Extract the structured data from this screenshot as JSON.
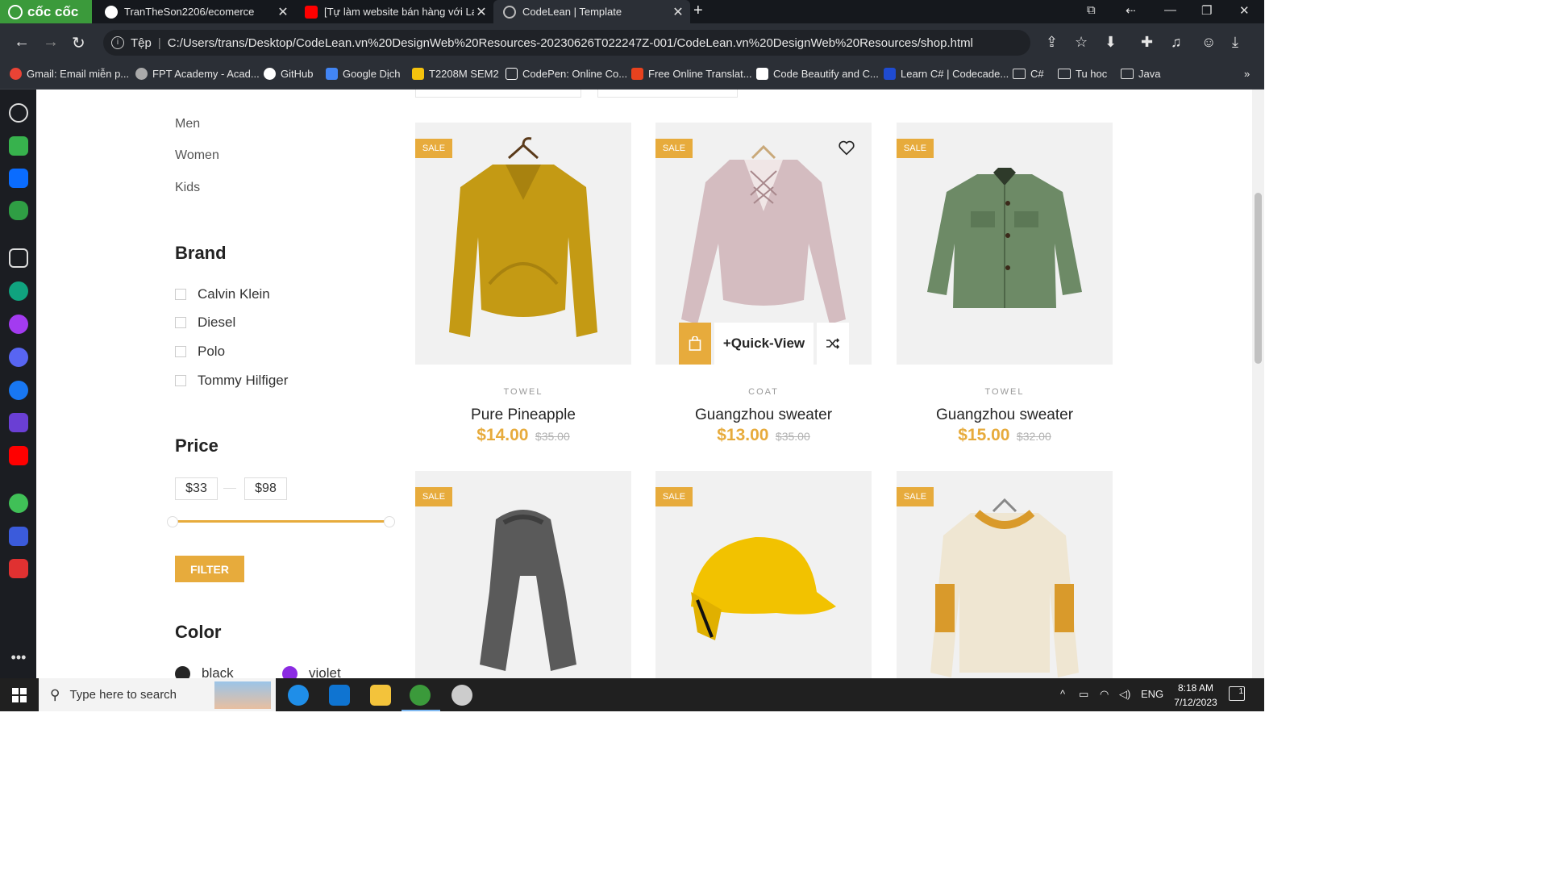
{
  "browser": {
    "brand": "cốc cốc",
    "tabs": [
      {
        "title": "TranTheSon2206/ecomerce"
      },
      {
        "title": "[Tự làm website bán hàng với Lara"
      },
      {
        "title": "CodeLean | Template"
      }
    ],
    "address": {
      "secure_label": "Tệp",
      "url": "C:/Users/trans/Desktop/CodeLean.vn%20DesignWeb%20Resources-20230626T022247Z-001/CodeLean.vn%20DesignWeb%20Resources/shop.html"
    },
    "bookmarks": [
      "Gmail: Email miễn p...",
      "FPT Academy - Acad...",
      "GitHub",
      "Google Dịch",
      "T2208M SEM2",
      "CodePen: Online Co...",
      "Free Online Translat...",
      "Code Beautify and C...",
      "Learn C# | Codecade...",
      "C#",
      "Tu hoc",
      "Java"
    ]
  },
  "sidebar": {
    "categories": [
      "Men",
      "Women",
      "Kids"
    ],
    "brand_title": "Brand",
    "brands": [
      "Calvin Klein",
      "Diesel",
      "Polo",
      "Tommy Hilfiger"
    ],
    "price_title": "Price",
    "price_min": "$33",
    "price_max": "$98",
    "filter_label": "FILTER",
    "color_title": "Color",
    "colors": [
      {
        "name": "black",
        "hex": "#252525"
      },
      {
        "name": "violet",
        "hex": "#8b2be2"
      }
    ]
  },
  "products": [
    {
      "badge": "SALE",
      "category": "TOWEL",
      "name": "Pure Pineapple",
      "price": "$14.00",
      "old_price": "$35.00",
      "icon": "yellow-sweater"
    },
    {
      "badge": "SALE",
      "category": "COAT",
      "name": "Guangzhou sweater",
      "price": "$13.00",
      "old_price": "$35.00",
      "icon": "pink-sweater",
      "hover": {
        "quick_view": "+Quick-View"
      }
    },
    {
      "badge": "SALE",
      "category": "TOWEL",
      "name": "Guangzhou sweater",
      "price": "$15.00",
      "old_price": "$32.00",
      "icon": "green-jacket"
    },
    {
      "badge": "SALE",
      "icon": "grey-scarf"
    },
    {
      "badge": "SALE",
      "icon": "yellow-cap"
    },
    {
      "badge": "SALE",
      "icon": "cream-sweater"
    }
  ],
  "taskbar": {
    "search_placeholder": "Type here to search",
    "lang": "ENG",
    "time": "8:18 AM",
    "date": "7/12/2023",
    "notification_count": "1"
  },
  "colors": {
    "accent": "#e7ab3c",
    "chrome": "#2b2f36"
  }
}
